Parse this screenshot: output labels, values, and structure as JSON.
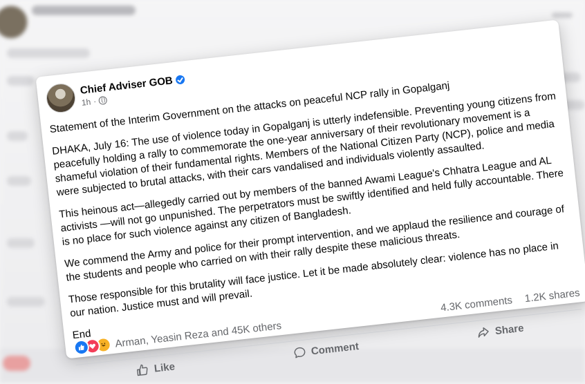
{
  "post": {
    "author": "Chief Adviser GOB",
    "time": "1h",
    "paragraphs": [
      "Statement of the Interim Government on the attacks on peaceful NCP rally in Gopalganj",
      "DHAKA, July 16: The use of violence today in Gopalganj is utterly indefensible. Preventing young citizens from peacefully holding a rally to commemorate the one-year anniversary of their revolutionary movement is a shameful violation of their fundamental rights. Members of the National Citizen Party (NCP), police and media were subjected to brutal attacks, with their cars vandalised and individuals violently assaulted.",
      "This heinous act—allegedly carried out by members of the banned Awami League's Chhatra League and AL activists —will not go unpunished. The perpetrators must be swiftly identified and held fully accountable. There is no place for such violence against any citizen of Bangladesh.",
      "We commend the Army and police for their prompt intervention, and we applaud the resilience and courage of the students and people who carried on with their rally despite these malicious threats.",
      "Those responsible for this brutality will face justice. Let it be made absolutely clear: violence has no place in our nation. Justice must and will prevail."
    ],
    "end_text": "End",
    "reaction_names": "Arman, Yeasin Reza and 45K others",
    "comments": "4.3K comments",
    "shares": "1.2K shares",
    "actions": {
      "like": "Like",
      "comment": "Comment",
      "share": "Share"
    }
  },
  "icons": {
    "verified": "verified-badge-icon",
    "privacy": "globe-icon",
    "like": "thumbs-up-icon",
    "comment": "speech-bubble-icon",
    "share": "share-arrow-icon"
  },
  "colors": {
    "accent": "#1877f2",
    "love": "#f33e58",
    "haha": "#f7b125",
    "text": "#050505",
    "muted": "#65676b"
  }
}
